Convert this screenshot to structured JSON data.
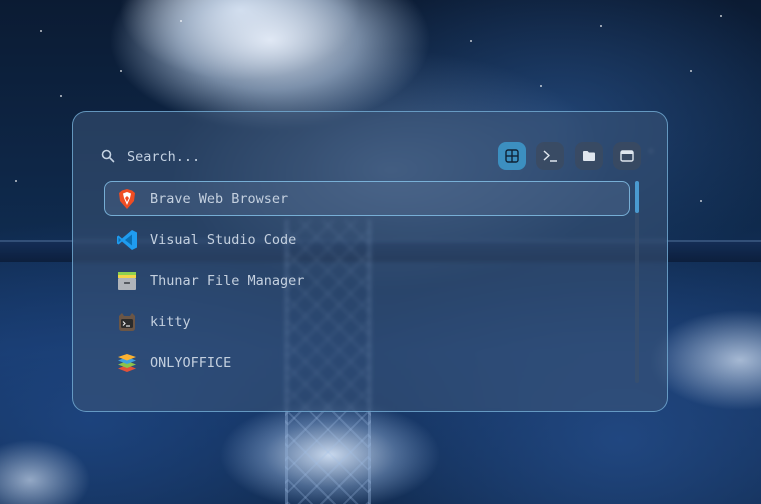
{
  "search": {
    "placeholder": "Search..."
  },
  "mode_buttons": [
    {
      "name": "apps",
      "icon": "grid-icon",
      "active": true
    },
    {
      "name": "terminal",
      "icon": "terminal-icon",
      "active": false
    },
    {
      "name": "files",
      "icon": "folder-icon",
      "active": false
    },
    {
      "name": "windows",
      "icon": "window-icon",
      "active": false
    }
  ],
  "apps": [
    {
      "label": "Brave Web Browser",
      "icon": "brave-icon",
      "selected": true
    },
    {
      "label": "Visual Studio Code",
      "icon": "vscode-icon",
      "selected": false
    },
    {
      "label": "Thunar File Manager",
      "icon": "thunar-icon",
      "selected": false
    },
    {
      "label": "kitty",
      "icon": "kitty-icon",
      "selected": false
    },
    {
      "label": "ONLYOFFICE",
      "icon": "onlyoffice-icon",
      "selected": false
    }
  ],
  "colors": {
    "accent": "#3c8fc0",
    "border": "#78b4dc",
    "text": "#c4d0df"
  }
}
